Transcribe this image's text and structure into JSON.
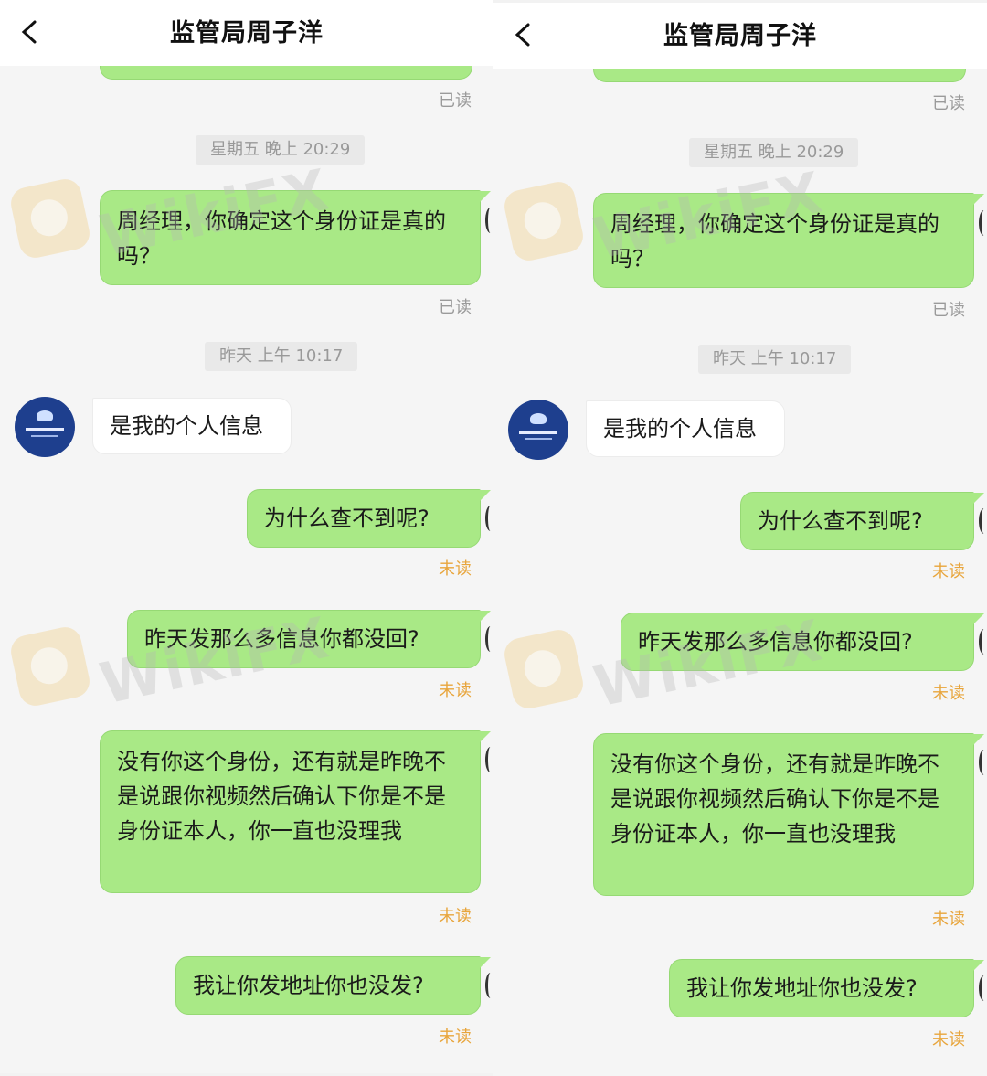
{
  "chat": {
    "title": "监管局周子洋",
    "messages": {
      "m1": "周经理，你确定这个身份证是真的吗？",
      "m2": "是我的个人信息",
      "m3": "为什么查不到呢?",
      "m4": "昨天发那么多信息你都没回?",
      "m5": "没有你这个身份，还有就是昨晚不是说跟你视频然后确认下你是不是身份证本人，你一直也没理我",
      "m6": "我让你发地址你也没发?"
    },
    "times": {
      "t1": "星期五 晚上 20:29",
      "t2": "昨天 上午 10:17"
    },
    "status": {
      "read": "已读",
      "unread": "未读"
    }
  },
  "watermark": {
    "text": "WikiFX"
  },
  "colors": {
    "bubble_out": "#a9e986",
    "unread": "#e8a53c",
    "avatar": "#1e3f8e"
  },
  "icons": {
    "back": "chevron-left-icon",
    "watermark_logo": "wikifx-logo-icon"
  }
}
